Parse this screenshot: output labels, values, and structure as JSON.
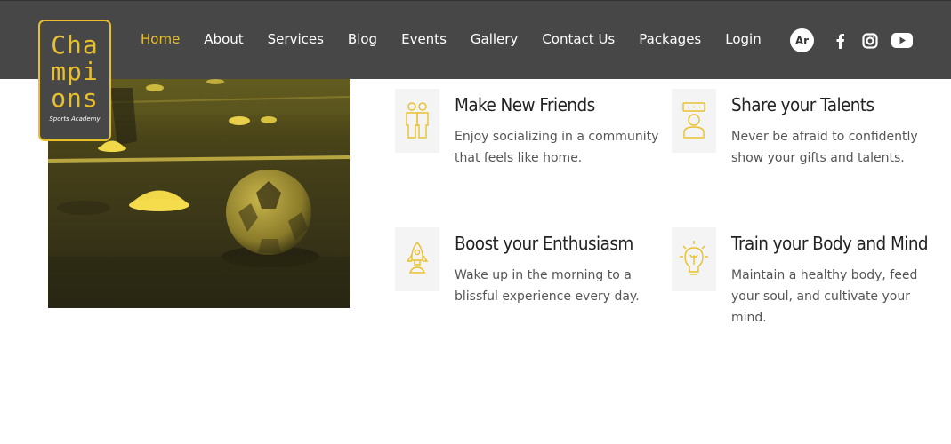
{
  "logo": {
    "line1": "Cha",
    "line2": "mpi",
    "line3": "ons",
    "tagline": "Sports Academy"
  },
  "nav": {
    "items": [
      {
        "label": "Home",
        "active": true
      },
      {
        "label": "About"
      },
      {
        "label": "Services"
      },
      {
        "label": "Blog"
      },
      {
        "label": "Events"
      },
      {
        "label": "Gallery"
      },
      {
        "label": "Contact Us"
      },
      {
        "label": "Packages"
      },
      {
        "label": "Login"
      }
    ]
  },
  "social": {
    "lang_label": "Ar",
    "icons": [
      "facebook-icon",
      "instagram-icon",
      "youtube-icon"
    ]
  },
  "features": [
    {
      "icon": "friends-icon",
      "title": "Make New Friends",
      "desc": "Enjoy socializing in a community that feels like home."
    },
    {
      "icon": "talent-icon",
      "title": "Share your Talents",
      "desc": "Never be afraid to confidently show your gifts and talents."
    },
    {
      "icon": "rocket-icon",
      "title": "Boost your Enthusiasm",
      "desc": "Wake up in the morning to a blissful experience every day."
    },
    {
      "icon": "lightbulb-icon",
      "title": "Train your Body and Mind",
      "desc": "Maintain a healthy body, feed your soul, and cultivate your mind."
    }
  ],
  "colors": {
    "accent": "#e8c02e",
    "header_bg": "#474747"
  }
}
